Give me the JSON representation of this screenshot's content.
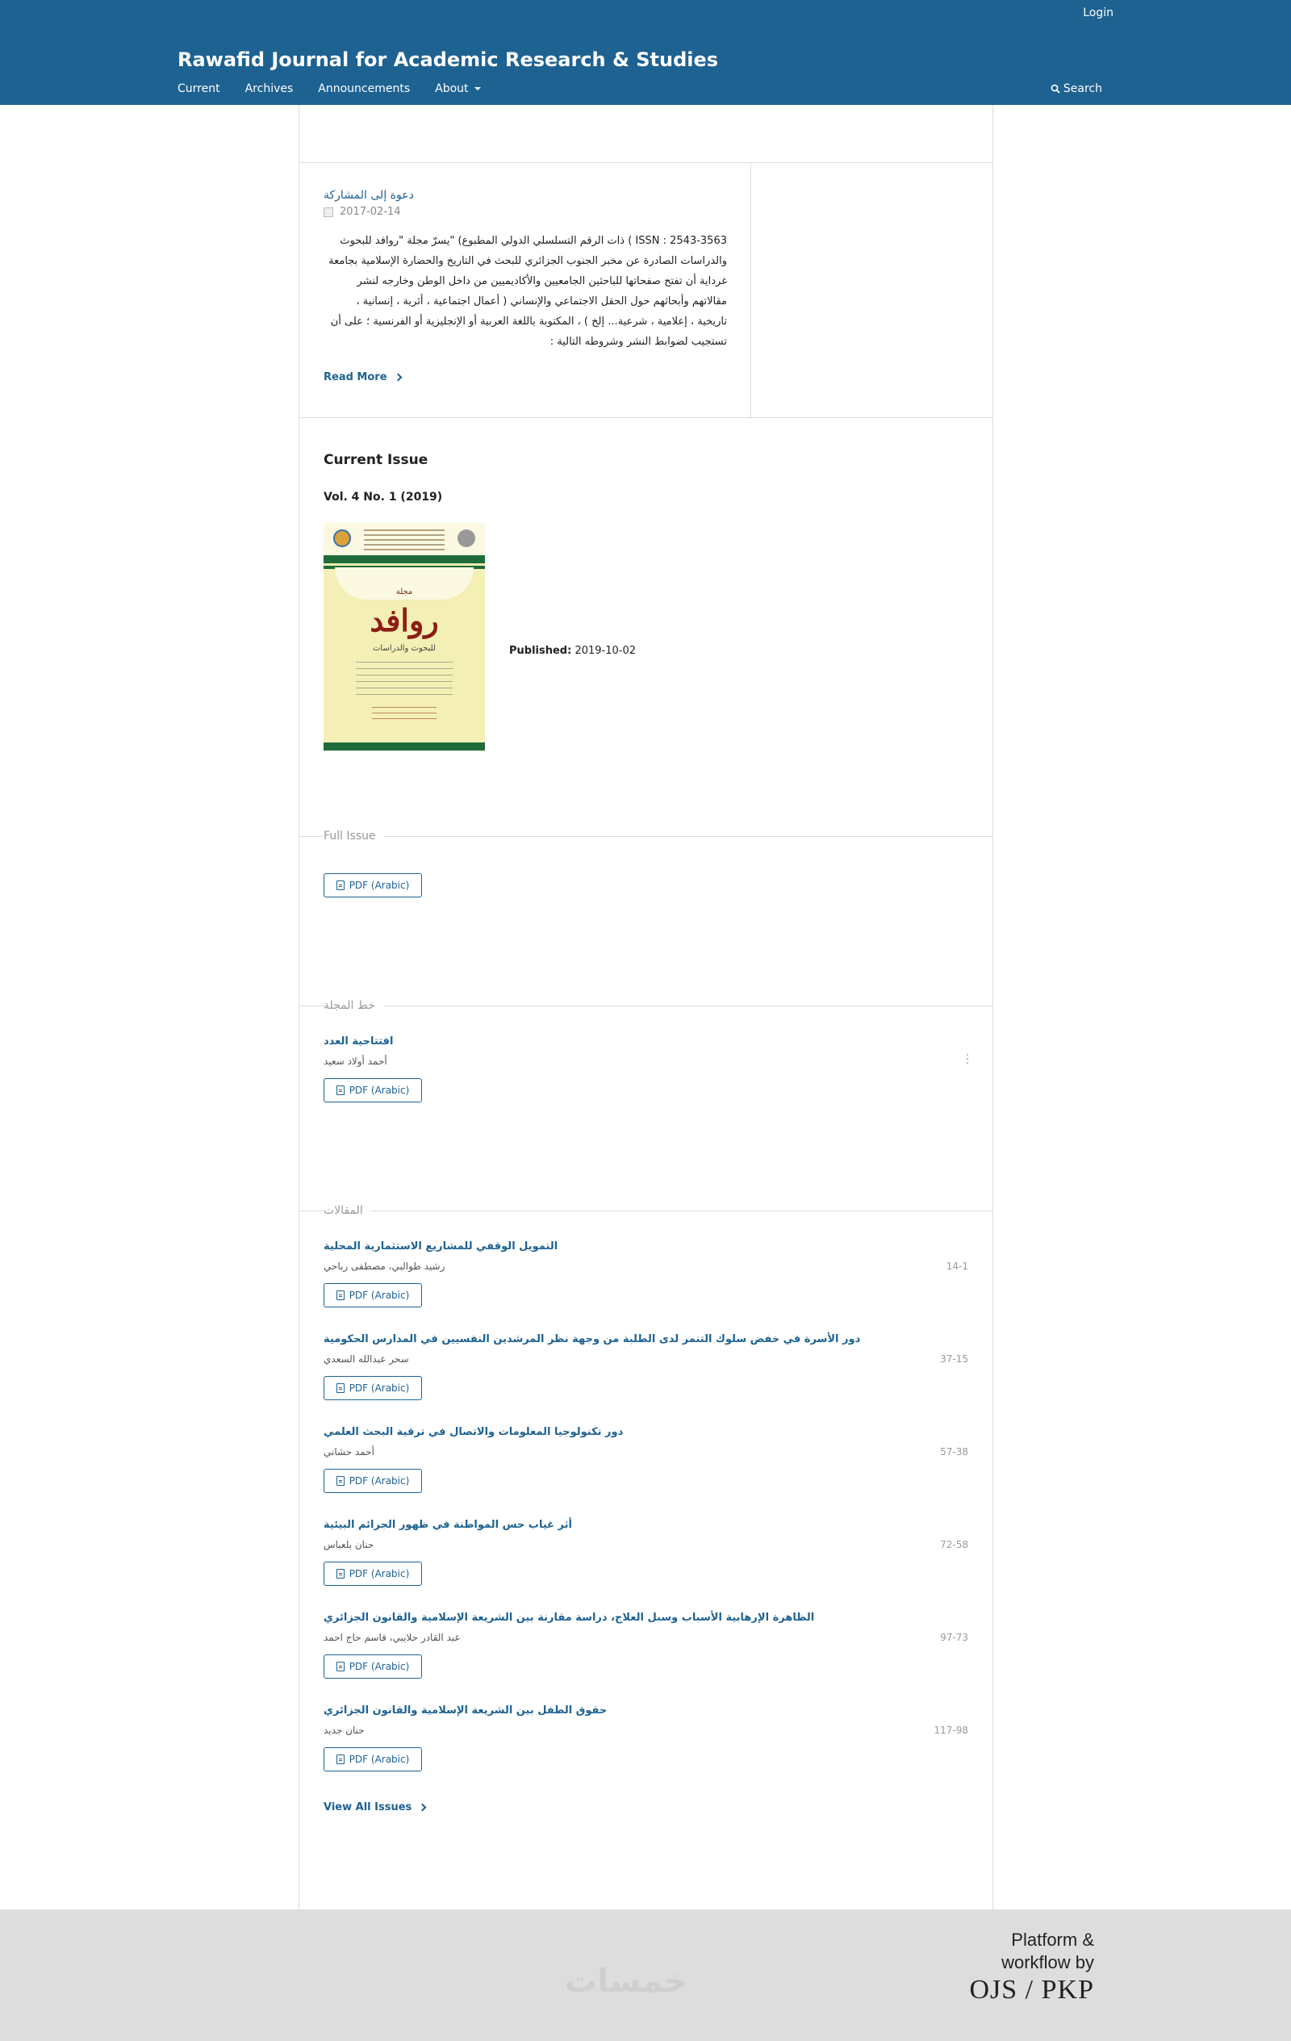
{
  "header": {
    "login": "Login",
    "site_title": "Rawafid Journal for Academic Research & Studies",
    "nav": [
      "Current",
      "Archives",
      "Announcements",
      "About"
    ],
    "search": "Search"
  },
  "announcement": {
    "title": "دعوة إلى المشاركة",
    "date": "2017-02-14",
    "body": "ISSN : 2543-3563 ) ذات الرقم التسلسلي الدولي المطبوع) \"يسرّ مجلة \"روافد للبحوث والدراسات الصادرة عن مخبر الجنوب الجزائري للبحث في التاريخ والحضارة الإسلامية بجامعة غرداية أن تفتح صفحاتها للباحثين الجامعيين والأكاديميين من داخل الوطن وخارجه لنشر مقالاتهم وأبحاثهم حول الحقل الاجتماعي والإنساني ( أعمال اجتماعية ، أثرية ، إنسانية ، تاريخية ، إعلامية ، شرعية... إلخ ) ، المكتوبة باللغة العربية أو الإنجليزية أو الفرنسية ؛ على أن تستجيب لضوابط النشر وشروطه التالية :",
    "read_more": "Read More"
  },
  "current_issue": {
    "heading": "Current Issue",
    "volume": "Vol. 4 No. 1 (2019)",
    "published_label": "Published:",
    "published_date": "2019-10-02",
    "cover": {
      "small": "مجلة",
      "big": "روافد",
      "sub": "للبحوث والدراسات"
    }
  },
  "full_issue": {
    "label": "Full Issue",
    "pdf": "PDF (Arabic)"
  },
  "editorial": {
    "label": "خط المجلة",
    "articles": [
      {
        "title": "افتتاحية العدد",
        "author": "أحمد أولاد سعيد",
        "pdf": "PDF (Arabic)"
      }
    ]
  },
  "articles_section": {
    "label": "المقالات",
    "articles": [
      {
        "title": "التمويل الوقفي للمشاريع الاستثمارية المحلية",
        "author": "رشيد طوالبي، مصطفى رباحي",
        "pages": "14-1",
        "pdf": "PDF (Arabic)"
      },
      {
        "title": "دور الأسرة في خفض سلوك التنمر لدى الطلبة من وجهة نظر المرشدين النفسيين في المدارس الحكومية",
        "author": "سحر عبدالله السعدي",
        "pages": "37-15",
        "pdf": "PDF (Arabic)"
      },
      {
        "title": "دور تكنولوجيا المعلومات والاتصال في ترقية البحث العلمي",
        "author": "أحمد حشاني",
        "pages": "57-38",
        "pdf": "PDF (Arabic)"
      },
      {
        "title": "أثر غياب حس المواطنة في ظهور الجرائم البيئية",
        "author": "حنان بلعباس",
        "pages": "72-58",
        "pdf": "PDF (Arabic)"
      },
      {
        "title": "الظاهرة الإرهابية الأسباب وسبل العلاج، دراسة مقارنة بين الشريعة الإسلامية والقانون الجزائري",
        "author": "عبد القادر حلايبي، قاسم حاج احمد",
        "pages": "97-73",
        "pdf": "PDF (Arabic)"
      },
      {
        "title": "حقوق الطفل بين الشريعة الإسلامية والقانون الجزائري",
        "author": "حنان جديد",
        "pages": "117-98",
        "pdf": "PDF (Arabic)"
      }
    ]
  },
  "view_all": "View All Issues",
  "footer": {
    "watermark": "خمسات",
    "brand_line1": "Platform &",
    "brand_line2": "workflow by",
    "brand_line3": "OJS / PKP"
  },
  "colors": {
    "header_bg": "#1e6292",
    "link": "#1e6292",
    "footer_bg": "#dddddd"
  }
}
